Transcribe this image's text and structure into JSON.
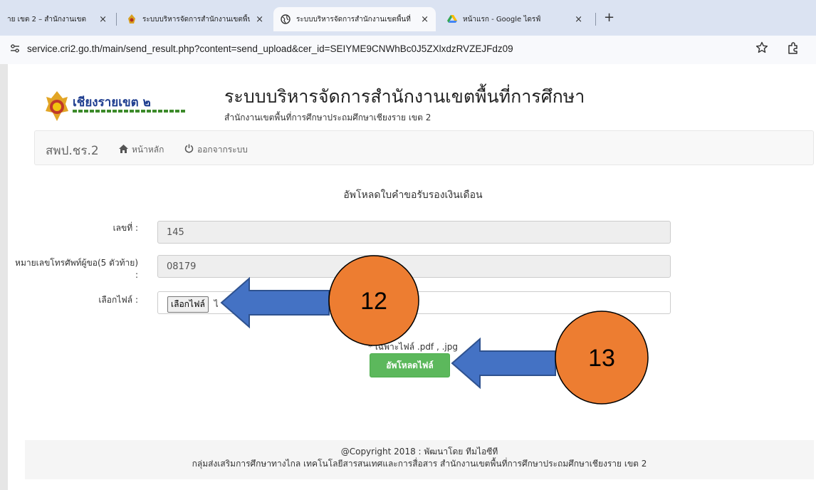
{
  "browser": {
    "tabs": [
      {
        "title": "าย เขต 2 – สำนักงานเขต",
        "active": false
      },
      {
        "title": "ระบบบริหารจัดการสำนักงานเขตพื้นที่",
        "active": false
      },
      {
        "title": "ระบบบริหารจัดการสำนักงานเขตพื้นที่",
        "active": true
      },
      {
        "title": "หน้าแรก - Google ไดรฟ์",
        "active": false
      }
    ],
    "close_glyph": "×",
    "new_tab_glyph": "+",
    "url": "service.cri2.go.th/main/send_result.php?content=send_upload&cer_id=SEIYME9CNWhBc0J5ZXlxdzRVZEJFdz09"
  },
  "header": {
    "logo_title": "เชียงรายเขต ๒",
    "site_title": "ระบบบริหารจัดการสำนักงานเขตพื้นที่การศึกษา",
    "site_subtitle": "สำนักงานเขตพื้นที่การศึกษาประถมศึกษาเชียงราย เขต 2"
  },
  "navbar": {
    "brand": "สพป.ชร.2",
    "home_label": "หน้าหลัก",
    "logout_label": "ออกจากระบบ"
  },
  "form": {
    "heading": "อัพโหลดใบคำขอรับรองเงินเดือน",
    "number_label": "เลขที่ :",
    "number_value": "145",
    "phone_label": "หมายเลขโทรศัพท์ผู้ขอ(5 ตัวท้าย) :",
    "phone_value": "08179",
    "file_label": "เลือกไฟล์ :",
    "file_button": "เลือกไฟล์",
    "file_status": "ไ",
    "note": "* เฉพาะไฟล์ .pdf , .jpg",
    "upload_button": "อัพโหลดไฟล์"
  },
  "footer": {
    "line1": "@Copyright 2018 : พัฒนาโดย ทีมไอซีที",
    "line2": "กลุ่มส่งเสริมการศึกษาทางไกล เทคโนโลยีสารสนเทศและการสื่อสาร สำนักงานเขตพื้นที่การศึกษาประถมศึกษาเชียงราย เขต 2"
  },
  "annotations": {
    "step_a": "12",
    "step_b": "13",
    "circle_color": "#ed7d31",
    "arrow_color": "#4472c4"
  }
}
